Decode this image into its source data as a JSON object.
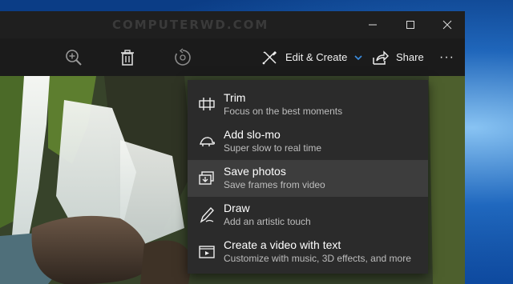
{
  "window": {
    "watermark": "COMPUTERWD.COM"
  },
  "toolbar": {
    "zoom_icon": "zoom-in-icon",
    "delete_icon": "trash-icon",
    "rotate_icon": "rotate-icon",
    "edit_create_label": "Edit & Create",
    "share_label": "Share",
    "more_label": "···"
  },
  "menu": {
    "items": [
      {
        "title": "Trim",
        "subtitle": "Focus on the best moments",
        "icon": "trim-icon"
      },
      {
        "title": "Add slo-mo",
        "subtitle": "Super slow to real time",
        "icon": "turtle-icon"
      },
      {
        "title": "Save photos",
        "subtitle": "Save frames from video",
        "icon": "save-photos-icon"
      },
      {
        "title": "Draw",
        "subtitle": "Add an artistic touch",
        "icon": "pen-icon"
      },
      {
        "title": "Create a video with text",
        "subtitle": "Customize with music, 3D effects, and more",
        "icon": "video-text-icon"
      }
    ],
    "highlighted_index": 2
  },
  "colors": {
    "accent": "#3b8de0",
    "menu_bg": "#2b2b2b",
    "toolbar_bg": "#1b1b1b"
  }
}
